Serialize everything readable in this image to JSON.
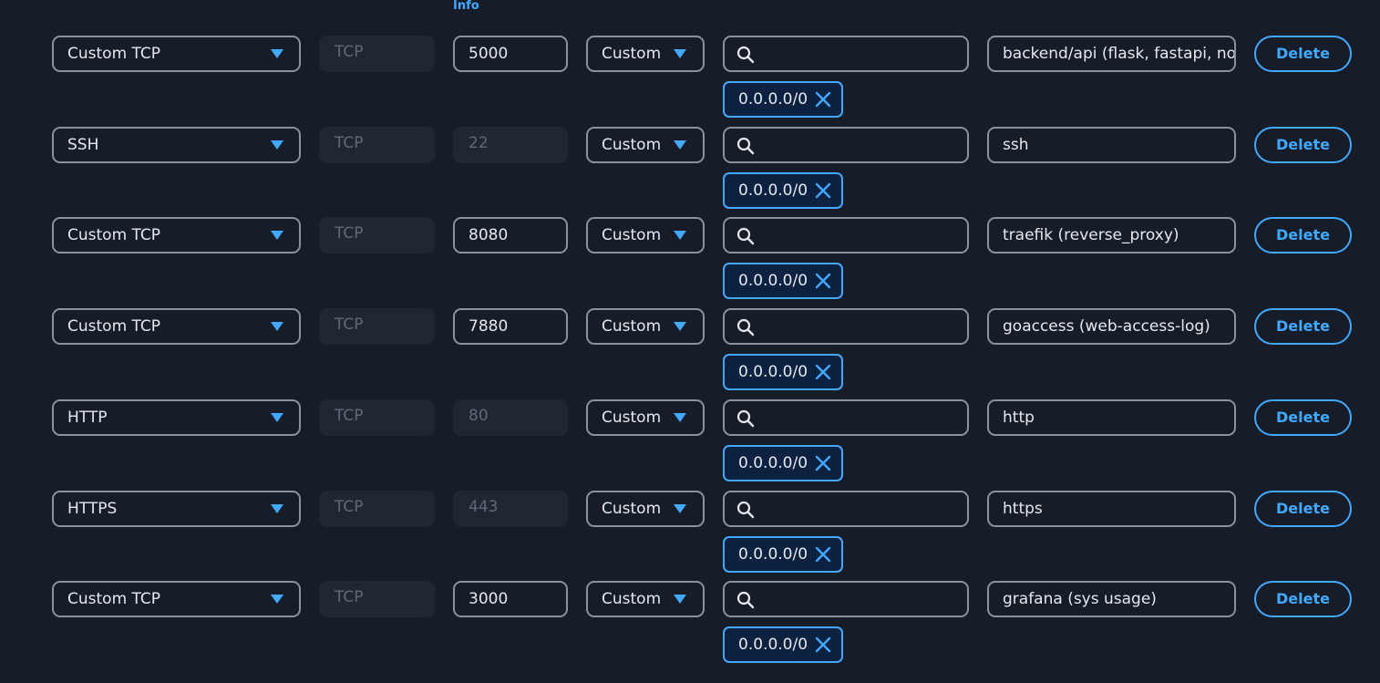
{
  "header": {
    "info_label": "Info"
  },
  "colors": {
    "accent": "#42a9ff",
    "border": "#8c929c",
    "background": "#161d29",
    "disabled_bg": "#1f2733",
    "token_bg": "#0d2240"
  },
  "icons": {
    "caret": "caret-down-icon",
    "search": "search-icon",
    "remove": "close-icon"
  },
  "rules": [
    {
      "type": "Custom TCP",
      "protocol": "TCP",
      "port": "5000",
      "port_editable": true,
      "source": "Custom",
      "search_value": "",
      "cidr": "0.0.0.0/0",
      "description": "backend/api (flask, fastapi, node)",
      "delete_label": "Delete"
    },
    {
      "type": "SSH",
      "protocol": "TCP",
      "port": "22",
      "port_editable": false,
      "source": "Custom",
      "search_value": "",
      "cidr": "0.0.0.0/0",
      "description": "ssh",
      "delete_label": "Delete"
    },
    {
      "type": "Custom TCP",
      "protocol": "TCP",
      "port": "8080",
      "port_editable": true,
      "source": "Custom",
      "search_value": "",
      "cidr": "0.0.0.0/0",
      "description": "traefik (reverse_proxy)",
      "delete_label": "Delete"
    },
    {
      "type": "Custom TCP",
      "protocol": "TCP",
      "port": "7880",
      "port_editable": true,
      "source": "Custom",
      "search_value": "",
      "cidr": "0.0.0.0/0",
      "description": "goaccess (web-access-log)",
      "delete_label": "Delete"
    },
    {
      "type": "HTTP",
      "protocol": "TCP",
      "port": "80",
      "port_editable": false,
      "source": "Custom",
      "search_value": "",
      "cidr": "0.0.0.0/0",
      "description": "http",
      "delete_label": "Delete"
    },
    {
      "type": "HTTPS",
      "protocol": "TCP",
      "port": "443",
      "port_editable": false,
      "source": "Custom",
      "search_value": "",
      "cidr": "0.0.0.0/0",
      "description": "https",
      "delete_label": "Delete"
    },
    {
      "type": "Custom TCP",
      "protocol": "TCP",
      "port": "3000",
      "port_editable": true,
      "source": "Custom",
      "search_value": "",
      "cidr": "0.0.0.0/0",
      "description": "grafana (sys usage)",
      "delete_label": "Delete"
    }
  ]
}
